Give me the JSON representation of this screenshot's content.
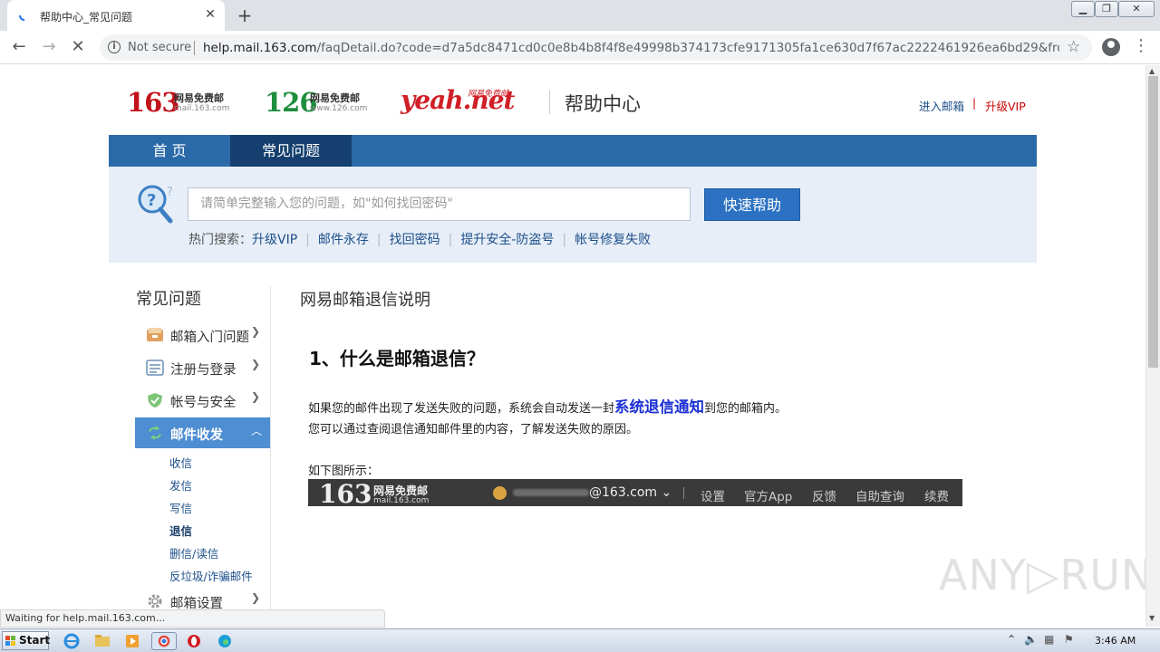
{
  "browser": {
    "tab_title": "帮助中心_常见问题",
    "tab_close": "✕",
    "new_tab": "+",
    "not_secure": "Not secure",
    "url_host": "help.mail.163.com",
    "url_rest": "/faqDetail.do?code=d7a5dc8471cd0c0e8b4b8f4f8e49998b374173cfe9171305fa1ce630d7f67ac2222461926ea6bd29&from=Bounc...",
    "status_text": "Waiting for help.mail.163.com..."
  },
  "header": {
    "logo163_num": "163",
    "logo163_text": "网易免费邮",
    "logo163_domain": "mail.163.com",
    "logo126_num": "126",
    "logo126_text": "网易免费邮",
    "logo126_domain": "www.126.com",
    "logoyeah_text": "yeah.net",
    "logoyeah_sub": "网易免费邮",
    "help_center": "帮助中心",
    "enter_mailbox": "进入邮箱",
    "separator": "|",
    "upgrade_vip": "升级VIP"
  },
  "nav": {
    "home": "首 页",
    "faq": "常见问题"
  },
  "search": {
    "placeholder": "请简单完整输入您的问题，如\"如何找回密码\"",
    "button": "快速帮助",
    "hot_label": "热门搜索：",
    "hot": [
      "升级VIP",
      "邮件永存",
      "找回密码",
      "提升安全-防盗号",
      "帐号修复失败"
    ]
  },
  "sidebar": {
    "title": "常见问题",
    "items": [
      {
        "label": "邮箱入门问题"
      },
      {
        "label": "注册与登录"
      },
      {
        "label": "帐号与安全"
      },
      {
        "label": "邮件收发"
      },
      {
        "label": "邮箱设置"
      }
    ],
    "subitems": [
      "收信",
      "发信",
      "写信",
      "退信",
      "删信/读信",
      "反垃圾/诈骗邮件"
    ]
  },
  "article": {
    "title": "网易邮箱退信说明",
    "q1": "1、什么是邮箱退信？",
    "p1_before": "如果您的邮件出现了发送失败的问题，系统会自动发送一封",
    "p1_highlight": "系统退信通知",
    "p1_after": "到您的邮箱内。",
    "p2": "您可以通过查阅退信通知邮件里的内容，了解发送失败的原因。",
    "p3": "如下图所示：",
    "screenshot": {
      "num": "163",
      "brand": "网易免费邮",
      "domain": "mail.163.com",
      "email": "@163.com ⌄",
      "menu": [
        "设置",
        "官方App",
        "反馈",
        "自助查询",
        "续费"
      ]
    }
  },
  "watermark": "ANY▷RUN",
  "taskbar": {
    "start": "Start",
    "clock": "3:46 AM"
  },
  "colors": {
    "nav_blue": "#2b6aa8",
    "nav_active": "#143f6e",
    "search_bg": "#e7eef7",
    "button_blue": "#2d72c2",
    "side_active": "#4e8ed2",
    "link_blue": "#1c4e8a",
    "red_163": "#c3121b",
    "green_126": "#1f8e3d"
  }
}
